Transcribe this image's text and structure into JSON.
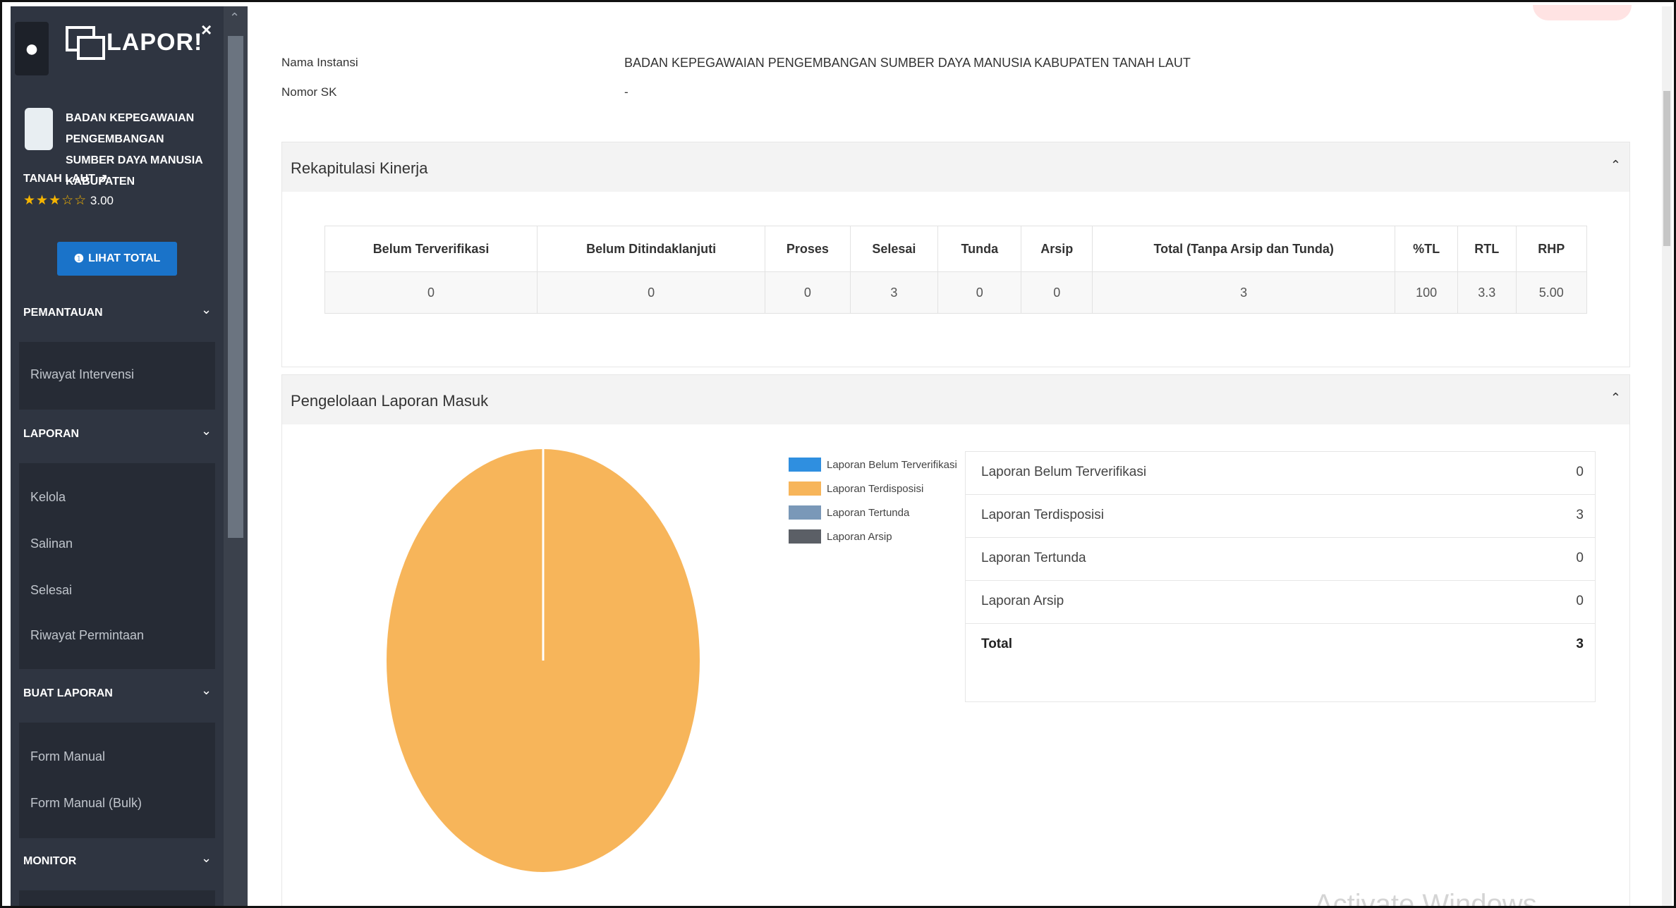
{
  "sidebar": {
    "logo_text": "LAPOR!",
    "close_glyph": "×",
    "org": {
      "name": "BADAN KEPEGAWAIAN PENGEMBANGAN SUMBER DAYA MANUSIA KABUPATEN",
      "name_line2": "TANAH LAUT",
      "stars": "★★★☆☆",
      "rating": "3.00"
    },
    "total_button": "LIHAT TOTAL",
    "sections": [
      {
        "title": "PEMANTAUAN",
        "items": [
          "Riwayat Intervensi"
        ]
      },
      {
        "title": "LAPORAN",
        "items": [
          "Kelola",
          "Salinan",
          "Selesai",
          "Riwayat Permintaan"
        ]
      },
      {
        "title": "BUAT LAPORAN",
        "items": [
          "Form Manual",
          "Form Manual (Bulk)"
        ]
      },
      {
        "title": "MONITOR",
        "items": []
      }
    ]
  },
  "info": {
    "instansi_label": "Nama Instansi",
    "instansi_value": "BADAN KEPEGAWAIAN PENGEMBANGAN SUMBER DAYA MANUSIA KABUPATEN TANAH LAUT",
    "sk_label": "Nomor SK",
    "sk_value": "-"
  },
  "rekap": {
    "title": "Rekapitulasi Kinerja",
    "headers": [
      "Belum Terverifikasi",
      "Belum Ditindaklanjuti",
      "Proses",
      "Selesai",
      "Tunda",
      "Arsip",
      "Total (Tanpa Arsip dan Tunda)",
      "%TL",
      "RTL",
      "RHP"
    ],
    "values": [
      "0",
      "0",
      "0",
      "3",
      "0",
      "0",
      "3",
      "100",
      "3.3",
      "5.00"
    ]
  },
  "pengelolaan": {
    "title": "Pengelolaan Laporan Masuk",
    "rows": [
      {
        "label": "Laporan Belum Terverifikasi",
        "value": "0"
      },
      {
        "label": "Laporan Terdisposisi",
        "value": "3"
      },
      {
        "label": "Laporan Tertunda",
        "value": "0"
      },
      {
        "label": "Laporan Arsip",
        "value": "0"
      },
      {
        "label": "Total",
        "value": "3"
      }
    ]
  },
  "watermark": "Activate Windows",
  "chart_data": {
    "type": "pie",
    "labels": [
      "Laporan Belum Terverifikasi",
      "Laporan Terdisposisi",
      "Laporan Tertunda",
      "Laporan Arsip"
    ],
    "values": [
      0,
      3,
      0,
      0
    ],
    "colors": [
      "#2f8fe0",
      "#f7b55a",
      "#7a98b8",
      "#5b5f66"
    ],
    "legend": "right"
  }
}
